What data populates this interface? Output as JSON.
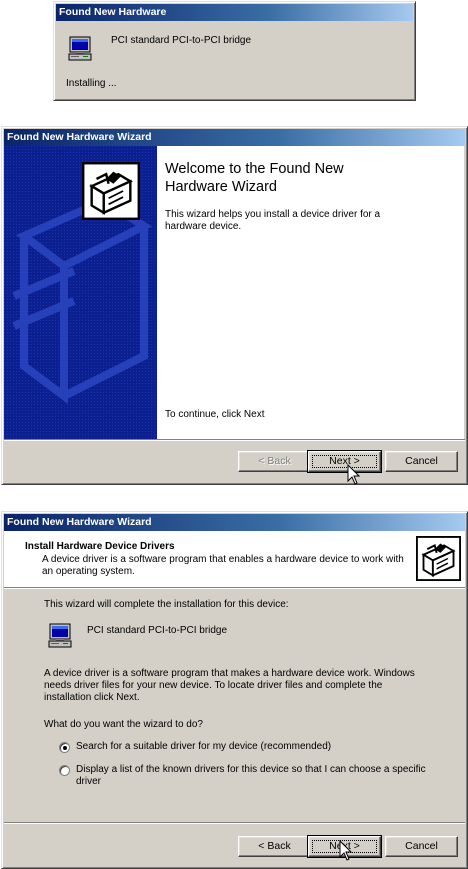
{
  "dialog1": {
    "title": "Found New Hardware",
    "device_name": "PCI standard PCI-to-PCI bridge",
    "status": "Installing ..."
  },
  "dialog2": {
    "title": "Found New Hardware Wizard",
    "heading_line1": "Welcome to the Found New",
    "heading_line2": "Hardware Wizard",
    "description": "This wizard helps you install a device driver for a hardware device.",
    "continue_text": "To continue, click Next",
    "back_label": "< Back",
    "next_label": "Next >",
    "cancel_label": "Cancel"
  },
  "dialog3": {
    "title": "Found New Hardware Wizard",
    "header_title": "Install Hardware Device Drivers",
    "header_subtitle": "A device driver is a software program that enables a hardware device to work with an operating system.",
    "intro_text": "This wizard will complete the installation for this device:",
    "device_name": "PCI standard PCI-to-PCI bridge",
    "driver_description": "A device driver is a software program that makes a hardware device work. Windows needs driver files for your new device. To locate driver files and complete the installation click Next.",
    "question": "What do you want the wizard to do?",
    "options": [
      {
        "label": "Search for a suitable driver for my device (recommended)",
        "selected": true
      },
      {
        "label": "Display a list of the known drivers for this device so that I can choose a specific driver",
        "selected": false
      }
    ],
    "back_label": "< Back",
    "next_label": "Next >",
    "cancel_label": "Cancel"
  },
  "icons": {
    "device": "computer-icon",
    "wizard": "hardware-box-icon",
    "pointer": "mouse-cursor-icon"
  },
  "colors": {
    "titlebar_start": "#0a246a",
    "titlebar_end": "#a6caf0",
    "dialog_face": "#d4d0c8",
    "banner_blue": "#0b1f8f"
  }
}
